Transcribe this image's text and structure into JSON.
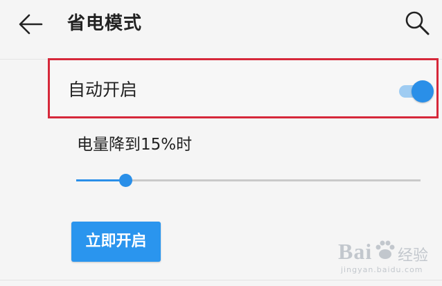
{
  "header": {
    "title": "省电模式",
    "back_icon": "back-arrow-icon",
    "search_icon": "search-icon"
  },
  "auto_start": {
    "label": "自动开启",
    "toggle_on": true
  },
  "threshold": {
    "label": "电量降到15%时",
    "slider_value_fraction": 0.143
  },
  "start_now": {
    "label": "立即开启"
  },
  "watermark": {
    "brand": "Bai",
    "word": "经验",
    "url": "jingyan.baidu.com"
  },
  "colors": {
    "accent": "#2a8fe8",
    "highlight_border": "#d6283a",
    "background": "#f5f5f5"
  }
}
